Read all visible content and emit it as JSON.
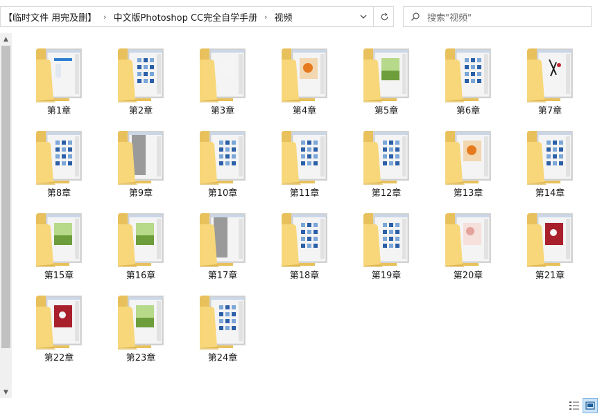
{
  "breadcrumb": {
    "items": [
      "【临时文件 用完及删】",
      "中文版Photoshop CC完全自学手册",
      "视频"
    ]
  },
  "search": {
    "placeholder": "搜索\"视频\""
  },
  "folders": [
    {
      "label": "第1章",
      "thumb": "window"
    },
    {
      "label": "第2章",
      "thumb": "grid"
    },
    {
      "label": "第3章",
      "thumb": "blank"
    },
    {
      "label": "第4章",
      "thumb": "photo-orange"
    },
    {
      "label": "第5章",
      "thumb": "photo-green"
    },
    {
      "label": "第6章",
      "thumb": "grid"
    },
    {
      "label": "第7章",
      "thumb": "figure"
    },
    {
      "label": "第8章",
      "thumb": "grid"
    },
    {
      "label": "第9章",
      "thumb": "gray"
    },
    {
      "label": "第10章",
      "thumb": "grid"
    },
    {
      "label": "第11章",
      "thumb": "grid"
    },
    {
      "label": "第12章",
      "thumb": "grid"
    },
    {
      "label": "第13章",
      "thumb": "photo-orange"
    },
    {
      "label": "第14章",
      "thumb": "grid"
    },
    {
      "label": "第15章",
      "thumb": "photo-green"
    },
    {
      "label": "第16章",
      "thumb": "photo-green"
    },
    {
      "label": "第17章",
      "thumb": "gray"
    },
    {
      "label": "第18章",
      "thumb": "grid"
    },
    {
      "label": "第19章",
      "thumb": "grid"
    },
    {
      "label": "第20章",
      "thumb": "photo-pink"
    },
    {
      "label": "第21章",
      "thumb": "photo-red"
    },
    {
      "label": "第22章",
      "thumb": "photo-red"
    },
    {
      "label": "第23章",
      "thumb": "photo-green"
    },
    {
      "label": "第24章",
      "thumb": "grid"
    }
  ],
  "colors": {
    "folder_back": "#e8c15c",
    "folder_front": "#f7d77a",
    "folder_shadow": "#d9ad3f",
    "selection": "#cce4f7"
  },
  "icons": {
    "dropdown": "chevron-down-icon",
    "refresh": "refresh-icon",
    "search": "search-icon",
    "scroll_up": "scroll-up-arrow-icon",
    "scroll_down": "scroll-down-arrow-icon",
    "details_view": "details-view-icon",
    "large_icons_view": "large-icons-view-icon"
  }
}
